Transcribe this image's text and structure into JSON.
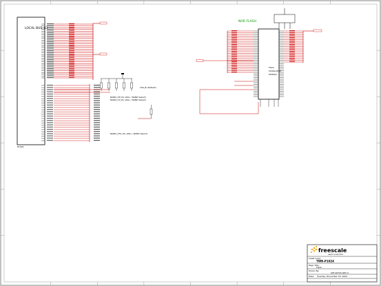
{
  "local_bus": {
    "title": "LOCAL BUS_G1",
    "footer": "P1024"
  },
  "nor_flash": {
    "title": "NOR FLASH",
    "part_name": "Flash",
    "part_number": "S29GL01GP",
    "part_code": "MX29LV"
  },
  "title_block": {
    "brand": "freescale",
    "brand_sub": "semiconductor",
    "rows": [
      {
        "label": "CAGE Code:",
        "value": "TWR-P1024"
      },
      {
        "label": "Page Title:",
        "value": "Flash"
      },
      {
        "label": "Drawn By:",
        "value": "SPF-26750 REV X"
      },
      {
        "label": "Date:",
        "value": "Tuesday, November 03, 2009"
      }
    ]
  },
  "annotations": {
    "note_left_1": "NAND_CE  (for eNor / NAND Select)",
    "note_left_2": "NAND_CS  (for eNor / NAND Select)",
    "note_left_3": "NAND_RD  Fix",
    "note_left_4": "NAND_GPIO  Fix",
    "note_cs": "CS0_B (Default)",
    "note_bottom": "NAND_CFG  (for eNor / NAND Select)"
  },
  "colors": {
    "bus_wire": "#cc0000",
    "green_net": "#009900",
    "blue_text": "#0000cc",
    "component": "#000000"
  }
}
